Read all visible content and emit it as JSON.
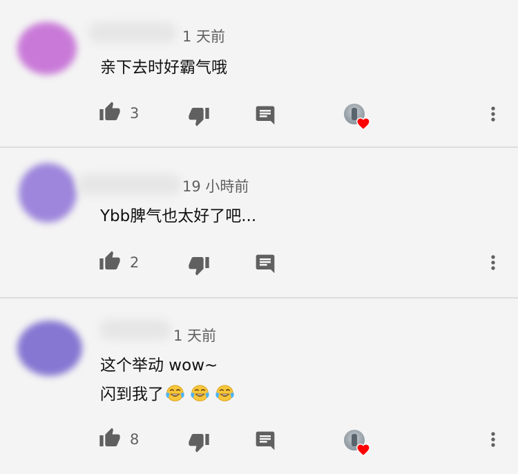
{
  "theme": {
    "background": "#f4f4f4",
    "icon_color": "#606060",
    "heart_color": "#ff0000",
    "divider": "#dcdcdc"
  },
  "comments": [
    {
      "time": "1 天前",
      "lines": [
        "亲下去时好霸气哦"
      ],
      "likes": "3",
      "creator_heart": true,
      "avatar_color": "#c97ad8"
    },
    {
      "time": "19 小時前",
      "lines": [
        "Ybb脾气也太好了吧..."
      ],
      "likes": "2",
      "creator_heart": false,
      "avatar_color": "#9d86dc"
    },
    {
      "time": "1 天前",
      "lines": [
        "这个举动 wow~",
        "闪到我了"
      ],
      "emojis": [
        "face-with-tears-of-joy",
        "face-with-tears-of-joy",
        "face-with-tears-of-joy"
      ],
      "likes": "8",
      "creator_heart": true,
      "avatar_color": "#8577d2"
    }
  ],
  "icons": {
    "like": "thumbs-up-icon",
    "dislike": "thumbs-down-icon",
    "reply": "reply-icon",
    "more": "more-vert-icon",
    "heart": "heart-icon"
  }
}
